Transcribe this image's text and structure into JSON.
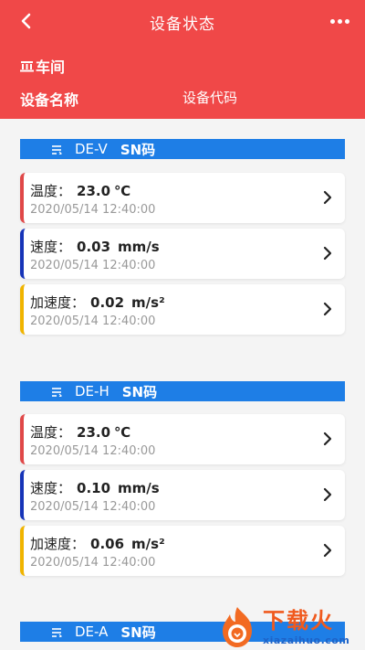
{
  "header": {
    "title": "设备状态",
    "workshop": "车间",
    "device_name_label": "设备名称",
    "device_code_label": "设备代码"
  },
  "groups": [
    {
      "name": "DE-V",
      "code": "SN码",
      "cards": [
        {
          "label": "温度：",
          "value": "23.0",
          "unit": "℃",
          "time": "2020/05/14 12:40:00",
          "kind": "temp"
        },
        {
          "label": "速度：",
          "value": "0.03",
          "unit": "mm/s",
          "time": "2020/05/14 12:40:00",
          "kind": "speed"
        },
        {
          "label": "加速度：",
          "value": "0.02",
          "unit": "m/s²",
          "time": "2020/05/14 12:40:00",
          "kind": "accel"
        }
      ]
    },
    {
      "name": "DE-H",
      "code": "SN码",
      "cards": [
        {
          "label": "温度：",
          "value": "23.0",
          "unit": "℃",
          "time": "2020/05/14 12:40:00",
          "kind": "temp"
        },
        {
          "label": "速度：",
          "value": "0.10",
          "unit": "mm/s",
          "time": "2020/05/14 12:40:00",
          "kind": "speed"
        },
        {
          "label": "加速度：",
          "value": "0.06",
          "unit": "m/s²",
          "time": "2020/05/14 12:40:00",
          "kind": "accel"
        }
      ]
    },
    {
      "name": "DE-A",
      "code": "SN码",
      "cards": []
    }
  ],
  "colors": {
    "header_bg": "#f04848",
    "group_header_bg": "#1e7ee6",
    "temp": "#e04848",
    "speed": "#1634b8",
    "accel": "#f0b400"
  },
  "watermark": {
    "big": "下载火",
    "small": "xiazaihuo.com"
  }
}
